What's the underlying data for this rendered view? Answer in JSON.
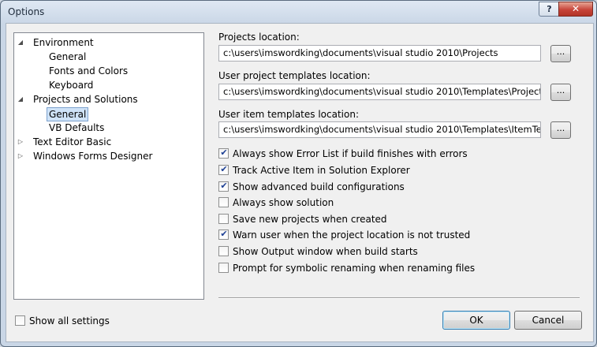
{
  "window": {
    "title": "Options",
    "help_label": "?",
    "close_label": "✕"
  },
  "tree": [
    {
      "label": "Environment",
      "state": "expanded"
    },
    {
      "label": "General",
      "state": "leaf"
    },
    {
      "label": "Fonts and Colors",
      "state": "leaf"
    },
    {
      "label": "Keyboard",
      "state": "leaf"
    },
    {
      "label": "Projects and Solutions",
      "state": "expanded"
    },
    {
      "label": "General",
      "state": "leaf",
      "selected": true
    },
    {
      "label": "VB Defaults",
      "state": "leaf"
    },
    {
      "label": "Text Editor Basic",
      "state": "collapsed"
    },
    {
      "label": "Windows Forms Designer",
      "state": "collapsed"
    }
  ],
  "fields": {
    "projects_location": {
      "label": "Projects location:",
      "value": "c:\\users\\imswordking\\documents\\visual studio 2010\\Projects"
    },
    "user_project_templates": {
      "label": "User project templates location:",
      "value": "c:\\users\\imswordking\\documents\\visual studio 2010\\Templates\\ProjectTem"
    },
    "user_item_templates": {
      "label": "User item templates location:",
      "value": "c:\\users\\imswordking\\documents\\visual studio 2010\\Templates\\ItemTempla"
    },
    "browse_label": "..."
  },
  "options": [
    {
      "label": "Always show Error List if build finishes with errors",
      "checked": true
    },
    {
      "label": "Track Active Item in Solution Explorer",
      "checked": true
    },
    {
      "label": "Show advanced build configurations",
      "checked": true
    },
    {
      "label": "Always show solution",
      "checked": false
    },
    {
      "label": "Save new projects when created",
      "checked": false
    },
    {
      "label": "Warn user when the project location is not trusted",
      "checked": true
    },
    {
      "label": "Show Output window when build starts",
      "checked": false
    },
    {
      "label": "Prompt for symbolic renaming when renaming files",
      "checked": false
    }
  ],
  "footer": {
    "show_all_settings": {
      "label": "Show all settings",
      "checked": false
    },
    "ok_label": "OK",
    "cancel_label": "Cancel"
  },
  "icons": {
    "expanded": "expanded-arrow-icon",
    "collapsed": "collapsed-arrow-icon",
    "check": "checkmark-icon"
  }
}
